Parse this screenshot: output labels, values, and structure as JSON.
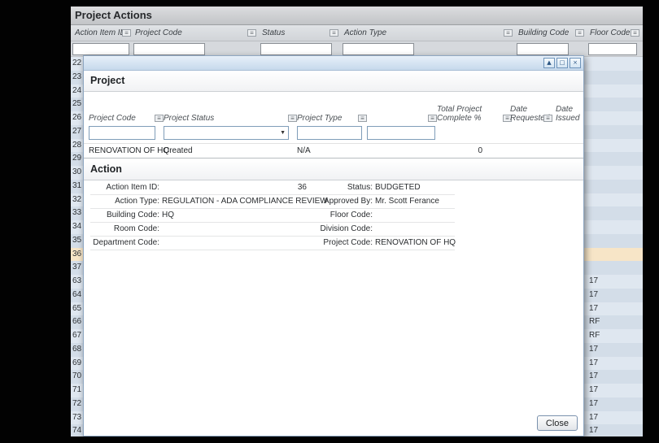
{
  "colors": {
    "row_a": "#dfe7f0",
    "row_b": "#d3dde8",
    "row_highlight": "#f7e5c7",
    "dialog_titlebar": "#cfe0f1"
  },
  "icons": {
    "filter": "≡",
    "dropdown": "▼",
    "collapse": "▲",
    "maximize": "□",
    "close": "×"
  },
  "app": {
    "title": "Project Actions"
  },
  "background_table": {
    "columns": [
      {
        "label": "Action Item ID"
      },
      {
        "label": "Project Code"
      },
      {
        "label": "Status"
      },
      {
        "label": "Action Type"
      },
      {
        "label": "Building Code"
      },
      {
        "label": "Floor Code"
      }
    ],
    "highlighted_id": "36",
    "rows": [
      {
        "id": "22",
        "floor": ""
      },
      {
        "id": "23",
        "floor": ""
      },
      {
        "id": "24",
        "floor": ""
      },
      {
        "id": "25",
        "floor": ""
      },
      {
        "id": "26",
        "floor": ""
      },
      {
        "id": "27",
        "floor": ""
      },
      {
        "id": "28",
        "floor": ""
      },
      {
        "id": "29",
        "floor": ""
      },
      {
        "id": "30",
        "floor": ""
      },
      {
        "id": "31",
        "floor": ""
      },
      {
        "id": "32",
        "floor": ""
      },
      {
        "id": "33",
        "floor": ""
      },
      {
        "id": "34",
        "floor": ""
      },
      {
        "id": "35",
        "floor": ""
      },
      {
        "id": "36",
        "floor": ""
      },
      {
        "id": "37",
        "floor": ""
      },
      {
        "id": "63",
        "floor": "17"
      },
      {
        "id": "64",
        "floor": "17"
      },
      {
        "id": "65",
        "floor": "17"
      },
      {
        "id": "66",
        "floor": "RF"
      },
      {
        "id": "67",
        "floor": "RF"
      },
      {
        "id": "68",
        "floor": "17"
      },
      {
        "id": "69",
        "floor": "17"
      },
      {
        "id": "70",
        "floor": "17"
      },
      {
        "id": "71",
        "floor": "17"
      },
      {
        "id": "72",
        "floor": "17"
      },
      {
        "id": "73",
        "floor": "17"
      },
      {
        "id": "74",
        "floor": "17"
      }
    ]
  },
  "dialog": {
    "project": {
      "title": "Project",
      "columns": [
        {
          "label": "Project Code"
        },
        {
          "label": "Project Status"
        },
        {
          "label": "Project Type"
        },
        {
          "label": ""
        },
        {
          "label": "Total Project Complete %"
        },
        {
          "label": "Date Requested"
        },
        {
          "label": "Date Issued"
        }
      ],
      "row": {
        "project_code": "RENOVATION OF HQ",
        "project_status": "Created",
        "project_type": "N/A",
        "total_project_complete": "0"
      }
    },
    "action": {
      "title": "Action",
      "rows": [
        {
          "label_a": "Action Item ID:",
          "value_a": "36",
          "label_b": "Status:",
          "value_b": "BUDGETED"
        },
        {
          "label_a": "Action Type:",
          "value_a": "REGULATION - ADA COMPLIANCE REVIEW",
          "label_b": "Approved By:",
          "value_b": "Mr. Scott Ferance"
        },
        {
          "label_a": "Building Code:",
          "value_a": "HQ",
          "label_b": "Floor Code:",
          "value_b": ""
        },
        {
          "label_a": "Room Code:",
          "value_a": "",
          "label_b": "Division Code:",
          "value_b": ""
        },
        {
          "label_a": "Department Code:",
          "value_a": "",
          "label_b": "Project Code:",
          "value_b": "RENOVATION OF HQ"
        }
      ]
    },
    "close_label": "Close"
  }
}
